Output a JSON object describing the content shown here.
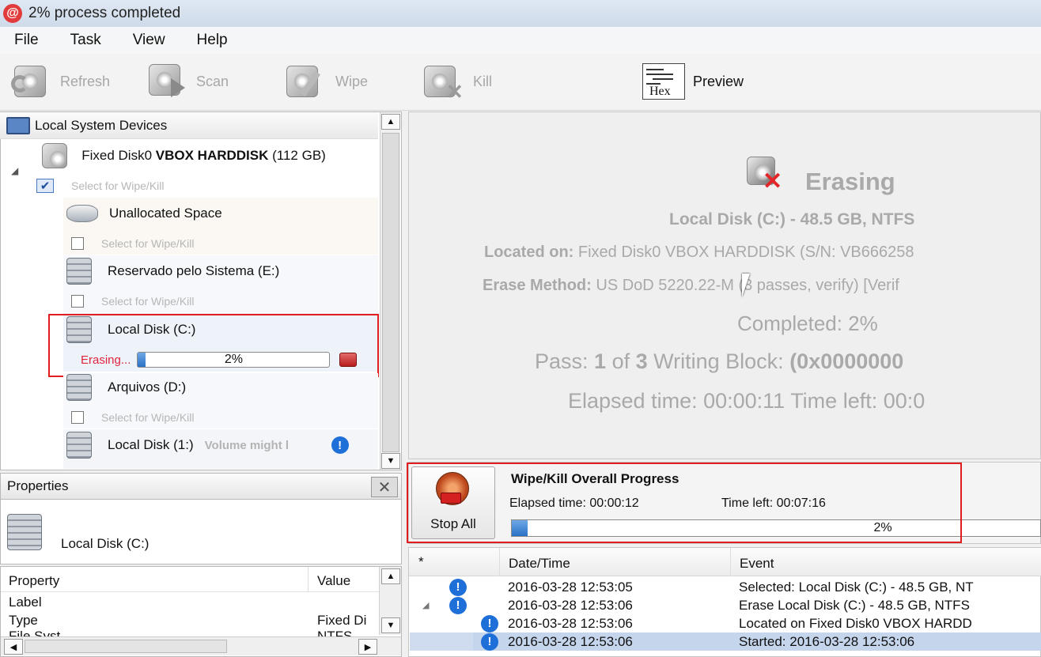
{
  "window": {
    "title": "2% process completed",
    "app_icon_glyph": "@"
  },
  "menu": [
    "File",
    "Task",
    "View",
    "Help"
  ],
  "toolbar": {
    "refresh": "Refresh",
    "scan": "Scan",
    "wipe": "Wipe",
    "kill": "Kill",
    "preview": "Preview",
    "hex_label": "Hex"
  },
  "tree": {
    "header": "Local System Devices",
    "disk": {
      "name_prefix": "Fixed Disk0 ",
      "name_bold": "VBOX HARDDISK",
      "size": " (112 GB)",
      "select": "Select for Wipe/Kill"
    },
    "items": [
      {
        "label": "Unallocated Space",
        "select": "Select for Wipe/Kill"
      },
      {
        "label": "Reservado pelo Sistema (E:)",
        "select": "Select for Wipe/Kill"
      },
      {
        "label": "Local Disk (C:)",
        "status": "Erasing...",
        "progress_text": "2%",
        "progress": 0.02
      },
      {
        "label": "Arquivos (D:)",
        "select": "Select for Wipe/Kill"
      },
      {
        "label": "Local Disk (1:)",
        "note": "Volume might l"
      }
    ]
  },
  "properties": {
    "title": "Properties",
    "selected": "Local Disk (C:)",
    "columns": [
      "Property",
      "Value"
    ],
    "rows": [
      {
        "property": "Label",
        "value": ""
      },
      {
        "property": "Type",
        "value": "Fixed Di"
      },
      {
        "property": "File Syst",
        "value": "NTFS"
      }
    ]
  },
  "status": {
    "heading": "Erasing",
    "disk": "Local Disk (C:) - 48.5 GB, NTFS",
    "located_label": "Located on:",
    "located_value": " Fixed Disk0 VBOX HARDDISK (S/N: VB666258",
    "method_label": "Erase Method:",
    "method_value": " US DoD 5220.22-M (3 passes, verify) [Verif",
    "completed": "Completed: 2%",
    "pass_pre": "Pass: ",
    "pass_cur": "1",
    "pass_mid": " of ",
    "pass_total": "3",
    "pass_post": " Writing Block: ",
    "block": "(0x0000000",
    "times": "Elapsed time: 00:00:11 Time left: 00:0"
  },
  "overall": {
    "title": "Wipe/Kill Overall Progress",
    "elapsed": "Elapsed time: 00:00:12",
    "left": "Time left: 00:07:16",
    "progress_text": "2%",
    "progress": 0.02,
    "stop_all": "Stop All"
  },
  "log": {
    "columns": [
      "*",
      "Date/Time",
      "Event"
    ],
    "rows": [
      {
        "time": "2016-03-28 12:53:05",
        "event": "Selected: Local Disk (C:) - 48.5 GB, NT"
      },
      {
        "time": "2016-03-28 12:53:06",
        "event": "Erase Local Disk (C:) - 48.5 GB, NTFS"
      },
      {
        "time": "2016-03-28 12:53:06",
        "event": "Located on Fixed Disk0 VBOX HARDD"
      },
      {
        "time": "2016-03-28 12:53:06",
        "event": "Started: 2016-03-28 12:53:06"
      }
    ]
  }
}
